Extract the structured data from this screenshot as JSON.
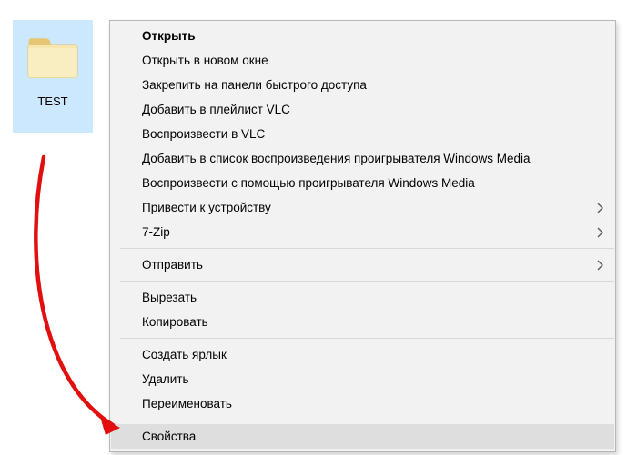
{
  "folder": {
    "name": "TEST"
  },
  "menu": {
    "open": "Открыть",
    "open_new_window": "Открыть в новом окне",
    "pin_quick_access": "Закрепить на панели быстрого доступа",
    "add_vlc_playlist": "Добавить в плейлист VLC",
    "play_vlc": "Воспроизвести в VLC",
    "add_wmp_list": "Добавить в список воспроизведения проигрывателя Windows Media",
    "play_wmp": "Воспроизвести с помощью проигрывателя Windows Media",
    "cast_to_device": "Привести к устройству",
    "seven_zip": "7-Zip",
    "send_to": "Отправить",
    "cut": "Вырезать",
    "copy": "Копировать",
    "create_shortcut": "Создать ярлык",
    "delete": "Удалить",
    "rename": "Переименовать",
    "properties": "Свойства"
  },
  "colors": {
    "selection": "#cce8ff",
    "menu_bg": "#f2f2f2",
    "menu_border": "#b7b7b7",
    "hover": "#dedede",
    "annotation": "#e20f0f"
  }
}
